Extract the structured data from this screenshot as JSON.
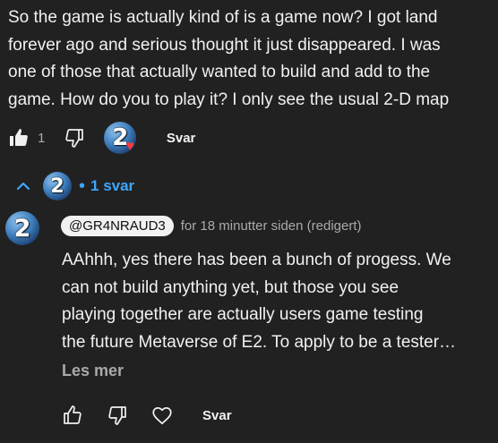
{
  "comment": {
    "text": "So the game is actually kind of is a game now? I got land\nforever ago and serious thought it just disappeared. I was\none of those that actually wanted to build and add to the\ngame. How do you to play it? I only see the usual 2-D map",
    "like_count": "1",
    "reply_label": "Svar",
    "hearted_by_creator": true,
    "creator_avatar_text": "2"
  },
  "replies_toggle": {
    "label": "1 svar",
    "avatar_text": "2"
  },
  "reply": {
    "avatar_text": "2",
    "author": "@GR4NRAUD3",
    "timestamp": "for 18 minutter siden (redigert)",
    "text": "AAhhh, yes there has been a bunch of progess. We\ncan not build anything yet, but those you see\nplaying together are actually users game testing\nthe future Metaverse of E2. To apply to be a tester…",
    "read_more": "Les mer",
    "reply_label": "Svar"
  },
  "colors": {
    "background": "#212121",
    "text": "#f1f1f1",
    "muted": "#aaaaaa",
    "link": "#3ea6ff",
    "heart": "#ff3b3b"
  }
}
